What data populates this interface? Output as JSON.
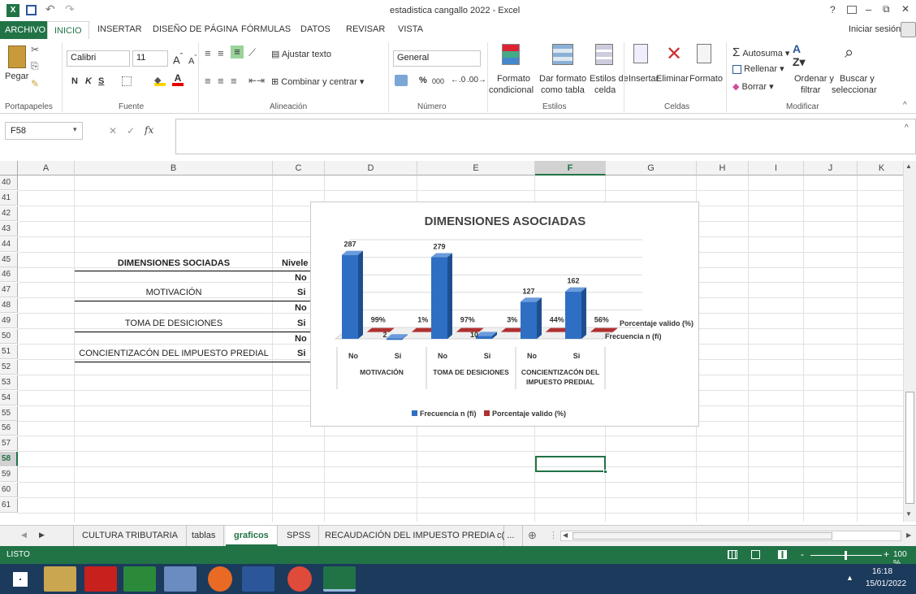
{
  "titlebar": {
    "title": "estadistica cangallo 2022 - Excel",
    "help": "?",
    "min": "–",
    "max": "⧉",
    "close": "✕"
  },
  "tabs": {
    "archivo": "ARCHIVO",
    "inicio": "INICIO",
    "insertar": "INSERTAR",
    "diseno": "DISEÑO DE PÁGINA",
    "formulas": "FÓRMULAS",
    "datos": "DATOS",
    "revisar": "REVISAR",
    "vista": "VISTA",
    "signin": "Iniciar sesión"
  },
  "ribbon": {
    "pegar": "Pegar",
    "font_name": "Calibri",
    "font_size": "11",
    "bold": "N",
    "italic": "K",
    "underline": "S",
    "ajustar": "Ajustar texto",
    "combinar": "Combinar y centrar",
    "numfmt": "General",
    "percent": "%",
    "thousands": "000",
    "formato_cond1": "Formato",
    "formato_cond2": "condicional",
    "dar_formato1": "Dar formato",
    "dar_formato2": "como tabla",
    "estilos1": "Estilos de",
    "estilos2": "celda",
    "insertar": "Insertar",
    "eliminar": "Eliminar",
    "formato": "Formato",
    "autosuma": "Autosuma",
    "rellenar": "Rellenar",
    "borrar": "Borrar",
    "ordenar1": "Ordenar y",
    "ordenar2": "filtrar",
    "buscar1": "Buscar y",
    "buscar2": "seleccionar",
    "groups": {
      "portapapeles": "Portapapeles",
      "fuente": "Fuente",
      "alineacion": "Alineación",
      "numero": "Número",
      "estilos": "Estilos",
      "celdas": "Celdas",
      "modificar": "Modificar"
    }
  },
  "formula_bar": {
    "namebox": "F58",
    "fx": "fx",
    "value": ""
  },
  "columns": [
    "A",
    "B",
    "C",
    "D",
    "E",
    "F",
    "G",
    "H",
    "I",
    "J",
    "K"
  ],
  "rows": [
    "40",
    "41",
    "42",
    "43",
    "44",
    "45",
    "46",
    "47",
    "48",
    "49",
    "50",
    "51",
    "52",
    "53",
    "54",
    "55",
    "56",
    "57",
    "58",
    "59",
    "60",
    "61"
  ],
  "cells": {
    "b45": "DIMENSIONES SOCIADAS",
    "c45": "Nivele",
    "c46": "No",
    "c47": "Si",
    "c48": "No",
    "c49": "Si",
    "c50": "No",
    "c51": "Si",
    "b47": "MOTIVACIÓN",
    "b49": "TOMA DE DESICIONES",
    "b51": "CONCIENTIZACÓN DEL IMPUESTO PREDIAL"
  },
  "chart_data": {
    "type": "bar",
    "title": "DIMENSIONES ASOCIADAS",
    "groups": [
      "MOTIVACIÓN",
      "TOMA DE DESICIONES",
      "CONCIENTIZACÓN DEL IMPUESTO PREDIAL"
    ],
    "categories": [
      "No",
      "Si",
      "No",
      "Si",
      "No",
      "Si"
    ],
    "series": [
      {
        "name": "Frecuencia n (fi)",
        "values": [
          287,
          2,
          279,
          10,
          127,
          162
        ],
        "labels": [
          "287",
          "2",
          "279",
          "10",
          "127",
          "162"
        ],
        "color": "#2e6fc4"
      },
      {
        "name": "Porcentaje valido (%)",
        "values": [
          99,
          1,
          97,
          3,
          44,
          56
        ],
        "labels": [
          "99%",
          "1%",
          "97%",
          "3%",
          "44%",
          "56%"
        ],
        "color": "#b03030"
      }
    ],
    "depth_labels": [
      "Porcentaje valido (%)",
      "Frecuencia n (fi)"
    ],
    "legend": [
      "Frecuencia n (fi)",
      "Porcentaje valido (%)"
    ],
    "legend_position": "bottom",
    "ylim": [
      0,
      300
    ]
  },
  "sheets": [
    "CULTURA TRIBUTARIA",
    "tablas",
    "graficos",
    "SPSS",
    "RECAUDACIÓN DEL IMPUESTO PREDIA",
    "c( ..."
  ],
  "status": {
    "left": "LISTO",
    "zoom": "100 %",
    "plus": "+",
    "minus": "-"
  },
  "taskbar": {
    "time": "16:18",
    "date": "15/01/2022"
  }
}
